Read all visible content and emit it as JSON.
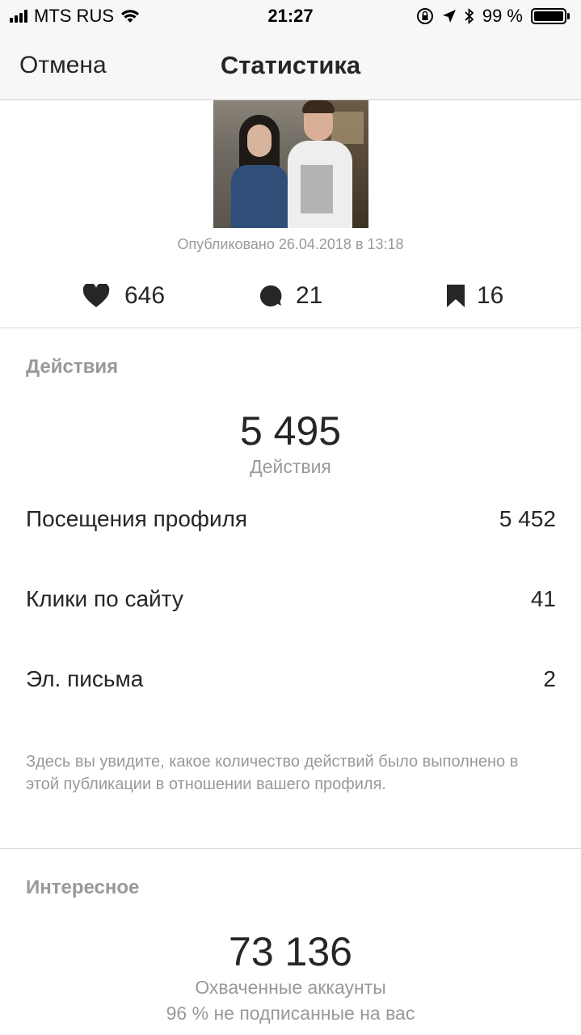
{
  "status_bar": {
    "carrier": "MTS RUS",
    "time": "21:27",
    "battery_percent": "99 %"
  },
  "nav": {
    "cancel_label": "Отмена",
    "title": "Статистика"
  },
  "post": {
    "published": "Опубликовано 26.04.2018 в 13:18",
    "likes": "646",
    "comments": "21",
    "saves": "16"
  },
  "actions": {
    "section_title": "Действия",
    "total": "5 495",
    "total_caption": "Действия",
    "rows": [
      {
        "label": "Посещения профиля",
        "value": "5 452"
      },
      {
        "label": "Клики по сайту",
        "value": "41"
      },
      {
        "label": "Эл. письма",
        "value": "2"
      }
    ],
    "note": "Здесь вы увидите, какое количество действий было выполнено в этой публикации в отношении вашего профиля."
  },
  "discovery": {
    "section_title": "Интересное",
    "reach": "73 136",
    "reach_caption": "Охваченные аккаунты",
    "non_followers": "96 % не подписанные на вас"
  },
  "icons": {
    "likes": "heart-icon",
    "comments": "comment-icon",
    "saves": "bookmark-icon"
  }
}
